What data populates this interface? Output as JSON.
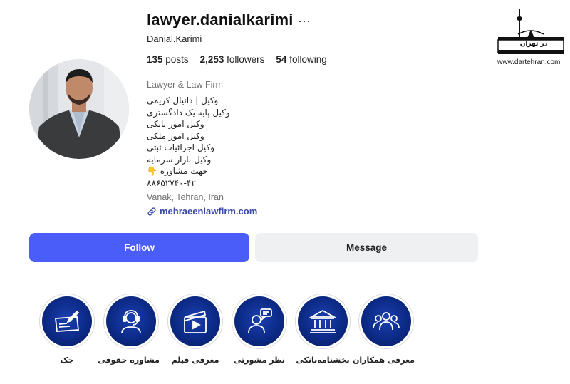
{
  "profile": {
    "username": "lawyer.danialkarimi",
    "more": "···",
    "full_name": "Danial.Karimi",
    "stats": {
      "posts_count": "135",
      "posts_label": "posts",
      "followers_count": "2,253",
      "followers_label": "followers",
      "following_count": "54",
      "following_label": "following"
    },
    "category": "Lawyer & Law Firm",
    "bio_lines": [
      "وکیل | دانیال کریمی",
      "وکیل پایه یک دادگستری",
      "وکیل امور بانکی",
      "وکیل امور ملکی",
      "وکیل اجرائیات ثبتی",
      "وکیل بازار سرمایه",
      "جهت مشاوره 👇",
      "۸۸۶۵۲۷۴۰-۴۲"
    ],
    "location": "Vanak, Tehran, Iran",
    "link": "mehraeenlawfirm.com"
  },
  "actions": {
    "follow_label": "Follow",
    "message_label": "Message"
  },
  "highlights": [
    {
      "label": "معرفی همکاران",
      "icon": "team-icon"
    },
    {
      "label": "بخشنامه‌بانکی",
      "icon": "bank-icon"
    },
    {
      "label": "نظر مشورتی",
      "icon": "consultant-chat-icon"
    },
    {
      "label": "معرفی فیلم",
      "icon": "video-clapper-icon"
    },
    {
      "label": "مشاوره حقوقی",
      "icon": "headset-agent-icon"
    },
    {
      "label": "چک",
      "icon": "cheque-icon"
    }
  ],
  "watermark": {
    "brand": "در تهران",
    "url": "www.dartehran.com"
  },
  "colors": {
    "follow_bg": "#4a5df9",
    "message_bg": "#eff0f2",
    "link": "#3b4aa8",
    "highlight_bg": "#0c2a86"
  }
}
